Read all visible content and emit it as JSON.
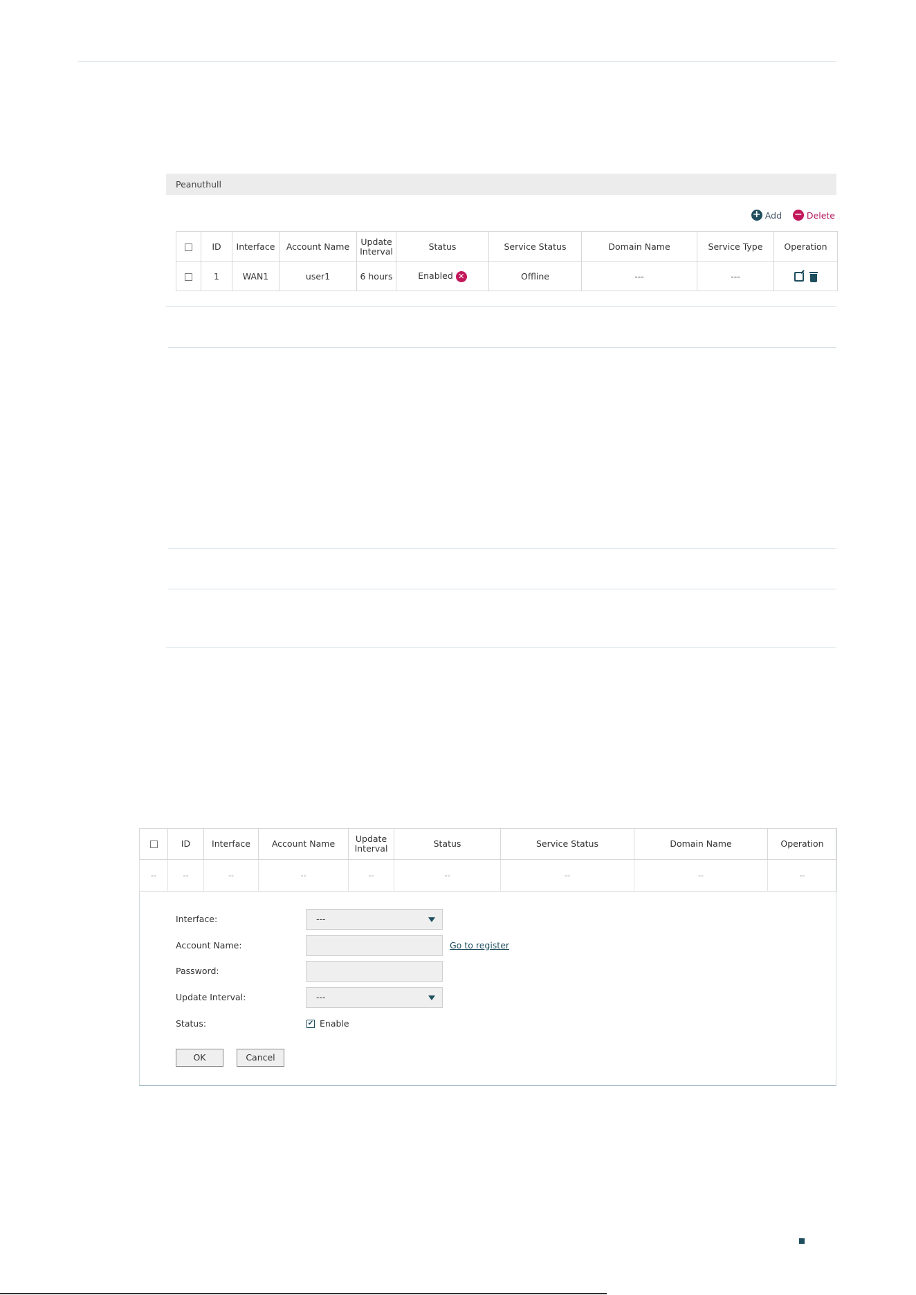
{
  "panel1": {
    "title": "Peanuthull",
    "add_label": "Add",
    "delete_label": "Delete",
    "columns": [
      "ID",
      "Interface",
      "Account Name",
      "Update Interval",
      "Status",
      "Service Status",
      "Domain Name",
      "Service Type",
      "Operation"
    ],
    "header": {
      "id": "ID",
      "interface": "Interface",
      "account_name": "Account Name",
      "update_line1": "Update",
      "update_line2": "Interval",
      "status": "Status",
      "service_status": "Service Status",
      "domain_name": "Domain Name",
      "service_type": "Service Type",
      "operation": "Operation"
    },
    "rows": [
      {
        "id": "1",
        "interface": "WAN1",
        "account_name": "user1",
        "update_interval": "6 hours",
        "status": "Enabled",
        "service_status": "Offline",
        "domain_name": "---",
        "service_type": "---"
      }
    ]
  },
  "panel2": {
    "header": {
      "id": "ID",
      "interface": "Interface",
      "account_name": "Account Name",
      "update_line1": "Update",
      "update_line2": "Interval",
      "status": "Status",
      "service_status": "Service Status",
      "domain_name": "Domain Name",
      "operation": "Operation"
    },
    "empty_row": [
      "--",
      "--",
      "--",
      "--",
      "--",
      "--",
      "--",
      "--",
      "--"
    ],
    "form": {
      "interface_label": "Interface:",
      "interface_value": "---",
      "account_name_label": "Account Name:",
      "account_name_value": "",
      "register_link": "Go to register",
      "password_label": "Password:",
      "password_value": "",
      "update_interval_label": "Update Interval:",
      "update_interval_value": "---",
      "status_label": "Status:",
      "enable_label": "Enable",
      "enable_checked": true,
      "ok_label": "OK",
      "cancel_label": "Cancel"
    }
  },
  "colors": {
    "accent": "#1f4e5f",
    "delete": "#c2185b",
    "panel_header_bg": "#ececec"
  }
}
